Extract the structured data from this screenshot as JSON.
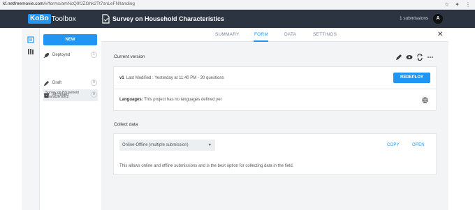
{
  "browser": {
    "url_host": "kf.netfreemovie.com",
    "url_path": "/#/forms/amNcQ9fJZGhk2Tt7snLeFN/landing"
  },
  "header": {
    "logo_ko": "KoBo",
    "logo_rest": "Toolbox",
    "project_title": "Survey on Household Characteristics",
    "submissions": "1 submissions",
    "avatar_letter": "A"
  },
  "sidebar": {
    "new_label": "NEW",
    "items": [
      {
        "label": "Deployed",
        "count": "1",
        "icon": "rocket-icon"
      },
      {
        "label": "Draft",
        "count": "0",
        "icon": "pencil-icon"
      },
      {
        "label": "Archived",
        "count": "0",
        "icon": "archive-icon"
      }
    ],
    "selected_project": "Survey on Household Characteristics"
  },
  "tabs": [
    {
      "label": "SUMMARY",
      "active": false
    },
    {
      "label": "FORM",
      "active": true
    },
    {
      "label": "DATA",
      "active": false
    },
    {
      "label": "SETTINGS",
      "active": false
    }
  ],
  "current_version": {
    "heading": "Current version",
    "version": "v1",
    "modified": "Last Modified : Yesterday at 11:40 PM - 30 questions",
    "redeploy_label": "REDEPLOY",
    "languages_label": "Languages:",
    "languages_text": "This project has no languages defined yet"
  },
  "collect": {
    "heading": "Collect data",
    "selected_option": "Online-Offline (multiple submission)",
    "copy_label": "COPY",
    "open_label": "OPEN",
    "description": "This allows online and offline submissions and is the best option for collecting data in the field."
  },
  "colors": {
    "accent": "#2095f3",
    "header_bg": "#2b3440"
  }
}
